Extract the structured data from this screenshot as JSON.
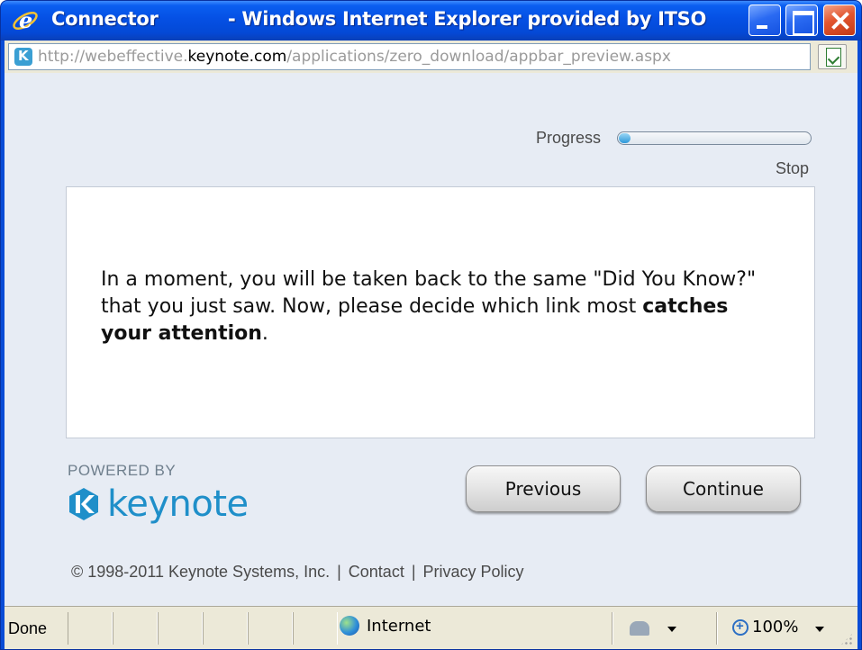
{
  "window": {
    "app_title": "Connector",
    "title_rest": "- Windows Internet Explorer provided by ITSO"
  },
  "address": {
    "prefix": "http://webeffective.",
    "host": "keynote.com",
    "path": "/applications/zero_download/appbar_preview.aspx"
  },
  "progress": {
    "label": "Progress",
    "value": 0.06,
    "stop_label": "Stop"
  },
  "message": {
    "text_before": "In a moment, you will be taken back to the same \"Did You Know?\" that you just saw. Now, please decide which link most ",
    "text_bold": "catches your attention",
    "text_after": "."
  },
  "branding": {
    "powered_by": "POWERED BY",
    "logo_word": "keynote",
    "color": "#1f8fc9"
  },
  "buttons": {
    "previous": "Previous",
    "continue": "Continue"
  },
  "footer": {
    "copyright": "© 1998-2011 Keynote Systems, Inc.",
    "separator": "|",
    "contact": "Contact",
    "privacy": "Privacy Policy"
  },
  "statusbar": {
    "status": "Done",
    "zone": "Internet",
    "zoom": "100%"
  },
  "colors": {
    "titlebar": "#0550e4",
    "content_bg": "#e7ecf4",
    "chrome": "#ece9d8"
  }
}
